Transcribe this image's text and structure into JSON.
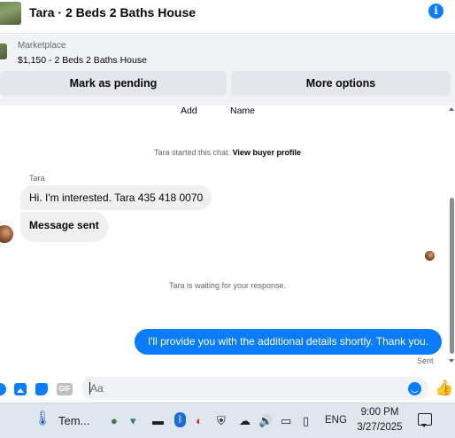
{
  "header": {
    "title": "Tara · 2 Beds 2 Baths House",
    "info_glyph": "i"
  },
  "marketplace": {
    "label": "Marketplace",
    "item": "$1,150 - 2 Beds 2 Baths House",
    "pending_button": "Mark as pending",
    "more_button": "More options"
  },
  "chat": {
    "add_label": "Add",
    "name_label": "Name",
    "started_text": "Tara started this chat.",
    "buyer_profile_link": "View buyer profile",
    "sender_name": "Tara",
    "messages_in": [
      "Hi. I'm interested. Tara 435 418 0070",
      "Message sent"
    ],
    "waiting_text": "Tara is waiting for your response.",
    "message_out": "I'll provide you with the additional details shortly. Thank you.",
    "sent_status": "Sent"
  },
  "composer": {
    "placeholder": "Aa",
    "gif_label": "GIF",
    "like_glyph": "👍"
  },
  "taskbar": {
    "temperature": "Tem...",
    "therm_glyph": "🌡",
    "bluetooth_glyph": "ᛒ",
    "language": "ENG",
    "time": "9:00 PM",
    "date": "3/27/2025"
  },
  "colors": {
    "accent": "#0a7cff",
    "bubble_in": "#f0f0f0",
    "panel_bg": "#f0f2f5",
    "button_bg": "#e4e6eb",
    "taskbar_bg": "#dfe6ee"
  },
  "icons": [
    "info-icon",
    "plus-icon",
    "photo-icon",
    "sticker-icon",
    "gif-icon",
    "emoji-icon",
    "like-icon",
    "thermometer-icon",
    "globe-icon",
    "wifi-icon",
    "battery-icon",
    "bluetooth-icon",
    "ccleaner-icon",
    "shield-icon",
    "cloud-icon",
    "volume-icon",
    "display-icon",
    "phone-icon",
    "notification-icon"
  ]
}
